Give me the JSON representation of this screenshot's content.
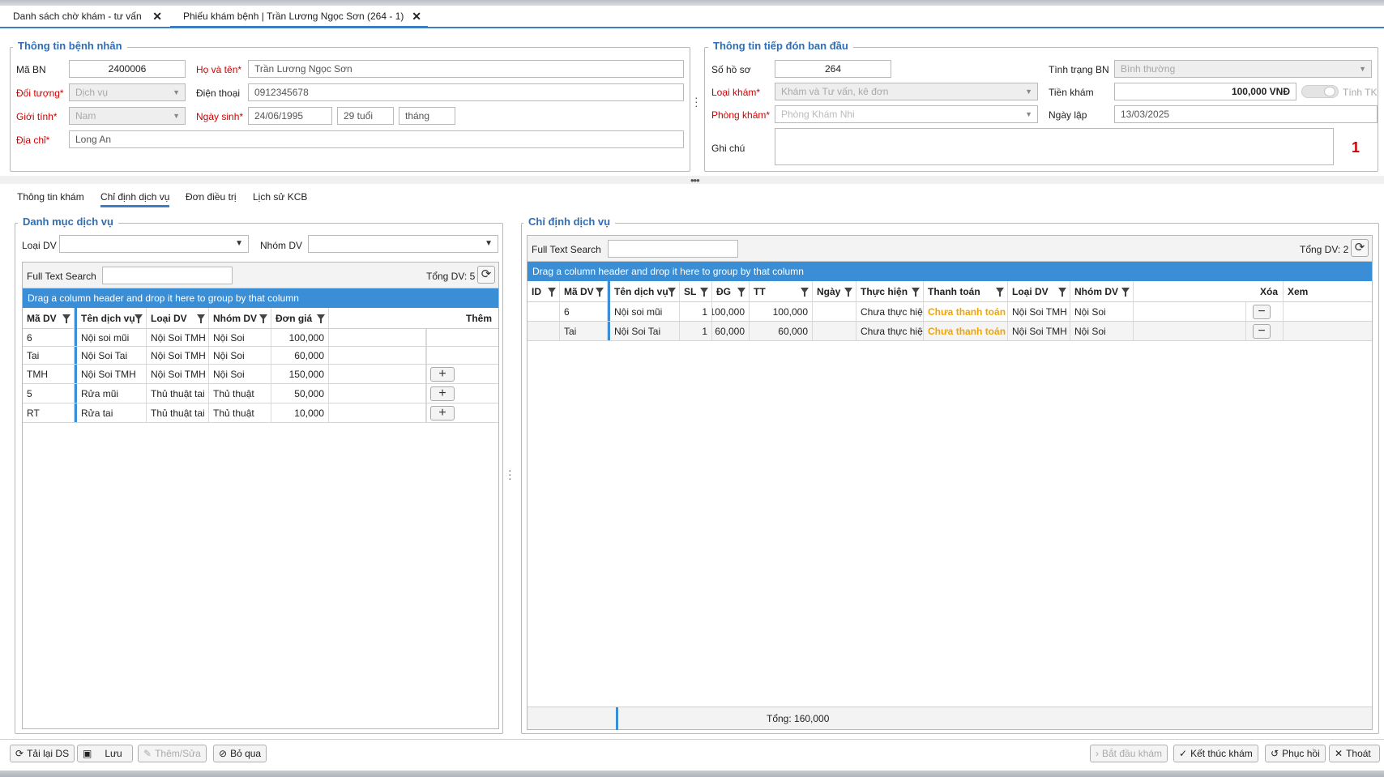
{
  "tabs": [
    {
      "label": "Danh sách chờ khám - tư vấn",
      "close": "✕"
    },
    {
      "label": "Phiếu khám bệnh | Trần Lương Ngọc Sơn (264 - 1)",
      "close": "✕"
    }
  ],
  "patient": {
    "legend": "Thông tin bệnh nhân",
    "ma_bn_label": "Mã BN",
    "ma_bn": "2400006",
    "ho_ten_label": "Họ và tên*",
    "ho_ten": "Trần Lương Ngọc Sơn",
    "doi_tuong_label": "Đối tượng*",
    "doi_tuong": "Dịch vụ",
    "dien_thoai_label": "Điện thoại",
    "dien_thoai": "0912345678",
    "gioi_tinh_label": "Giới tính*",
    "gioi_tinh": "Nam",
    "ngay_sinh_label": "Ngày sinh*",
    "ngay_sinh": "24/06/1995",
    "tuoi": "29 tuổi",
    "thang": "tháng",
    "dia_chi_label": "Địa chỉ*",
    "dia_chi": "Long An"
  },
  "reception": {
    "legend": "Thông tin tiếp đón ban đầu",
    "so_ho_so_label": "Số hồ sơ",
    "so_ho_so": "264",
    "loai_kham_label": "Loại khám*",
    "loai_kham": "Khám và Tư vấn, kê đơn",
    "phong_kham_label": "Phòng khám*",
    "phong_kham": "Phòng Khám Nhi",
    "tinh_trang_label": "Tình trạng BN",
    "tinh_trang": "Bình thường",
    "tien_kham_label": "Tiền khám",
    "tien_kham": "100,000 VNĐ",
    "tinh_tk_label": "Tính TK",
    "ngay_lap_label": "Ngày lập",
    "ngay_lap": "13/03/2025",
    "ghi_chu_label": "Ghi chú",
    "ghi_chu": "",
    "counter": "1"
  },
  "subtabs": [
    "Thông tin khám",
    "Chỉ định dịch vụ",
    "Đơn điều trị",
    "Lịch sử KCB"
  ],
  "catalog": {
    "legend": "Danh mục dịch vụ",
    "loai_dv_label": "Loại DV",
    "nhom_dv_label": "Nhóm DV",
    "search_label": "Full Text Search",
    "search_value": "",
    "total": "Tổng DV: 5",
    "dropzone": "Drag a column header and drop it here to group by that column",
    "columns": [
      "Mã DV",
      "Tên dịch vụ",
      "Loại DV",
      "Nhóm DV",
      "Đơn giá",
      "Thêm"
    ],
    "rows": [
      {
        "ma": "6",
        "ten": "Nội soi mũi",
        "loai": "Nội Soi TMH",
        "nhom": "Nội Soi",
        "gia": "100,000",
        "add": false
      },
      {
        "ma": "Tai",
        "ten": "Nội Soi Tai",
        "loai": "Nội Soi TMH",
        "nhom": "Nội Soi",
        "gia": "60,000",
        "add": false
      },
      {
        "ma": "TMH",
        "ten": "Nội Soi TMH",
        "loai": "Nội Soi TMH",
        "nhom": "Nội Soi",
        "gia": "150,000",
        "add": true
      },
      {
        "ma": "5",
        "ten": "Rửa mũi",
        "loai": "Thủ thuật tai",
        "nhom": "Thủ thuật",
        "gia": "50,000",
        "add": true
      },
      {
        "ma": "RT",
        "ten": "Rửa tai",
        "loai": "Thủ thuật tai",
        "nhom": "Thủ thuật",
        "gia": "10,000",
        "add": true
      }
    ]
  },
  "orders": {
    "legend": "Chỉ định dịch vụ",
    "search_label": "Full Text Search",
    "search_value": "",
    "total": "Tổng DV: 2",
    "dropzone": "Drag a column header and drop it here to group by that column",
    "columns": [
      "ID",
      "Mã DV",
      "Tên dịch vụ",
      "SL",
      "ĐG",
      "TT",
      "Ngày",
      "Thực hiện",
      "Thanh toán",
      "Loại DV",
      "Nhóm DV",
      "Xóa",
      "Xem"
    ],
    "rows": [
      {
        "id": "",
        "ma": "6",
        "ten": "Nội soi mũi",
        "sl": "1",
        "dg": "100,000",
        "tt": "100,000",
        "ngay": "",
        "thuc_hien": "Chưa thực hiện",
        "thanh_toan": "Chưa thanh toán",
        "loai": "Nội Soi TMH",
        "nhom": "Nội Soi"
      },
      {
        "id": "",
        "ma": "Tai",
        "ten": "Nội Soi Tai",
        "sl": "1",
        "dg": "60,000",
        "tt": "60,000",
        "ngay": "",
        "thuc_hien": "Chưa thực hiện",
        "thanh_toan": "Chưa thanh toán",
        "loai": "Nội Soi TMH",
        "nhom": "Nội Soi"
      }
    ],
    "footer_total": "Tổng: 160,000"
  },
  "bottom_buttons": {
    "reload": "Tải lại DS",
    "save": "Lưu",
    "add_edit": "Thêm/Sửa",
    "skip": "Bỏ qua",
    "start": "Bắt đầu khám",
    "finish": "Kết thúc khám",
    "restore": "Phục hồi",
    "exit": "Thoát"
  },
  "colors": {
    "accent": "#3d7dc4",
    "dropzone": "#3a8ed6",
    "required": "#d00000",
    "warning": "#f0a500"
  }
}
